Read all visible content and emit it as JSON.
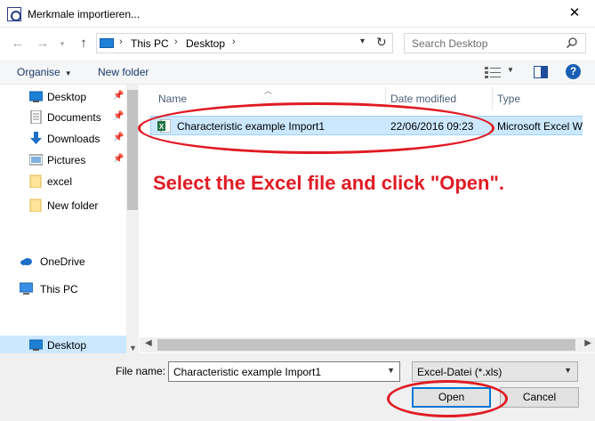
{
  "window": {
    "title": "Merkmale importieren..."
  },
  "address": {
    "segments": [
      "This PC",
      "Desktop"
    ]
  },
  "search": {
    "placeholder": "Search Desktop"
  },
  "toolbar": {
    "organise_label": "Organise",
    "new_folder_label": "New folder"
  },
  "nav": {
    "items": [
      {
        "label": "Desktop",
        "icon": "desktop-icon"
      },
      {
        "label": "Documents",
        "icon": "documents-icon"
      },
      {
        "label": "Downloads",
        "icon": "downloads-icon"
      },
      {
        "label": "Pictures",
        "icon": "pictures-icon"
      },
      {
        "label": "excel",
        "icon": "folder-icon"
      },
      {
        "label": "New folder",
        "icon": "folder-icon"
      },
      {
        "label": "OneDrive",
        "icon": "onedrive-icon"
      },
      {
        "label": "This PC",
        "icon": "this-pc-icon"
      },
      {
        "label": "Desktop",
        "icon": "desktop-icon"
      }
    ]
  },
  "columns": {
    "name": "Name",
    "date": "Date modified",
    "type": "Type"
  },
  "files": [
    {
      "name": "Characteristic example Import1",
      "date": "22/06/2016 09:23",
      "type": "Microsoft Excel W..."
    }
  ],
  "annotation": {
    "text": "Select the Excel file and click \"Open\"."
  },
  "footer": {
    "file_name_label": "File name:",
    "file_name_value": "Characteristic example Import1",
    "file_type_value": "Excel-Datei (*.xls)",
    "open_label": "Open",
    "cancel_label": "Cancel"
  },
  "colors": {
    "accent": "#0078d7",
    "selection": "#cce8ff",
    "annotation": "#e01b24"
  }
}
